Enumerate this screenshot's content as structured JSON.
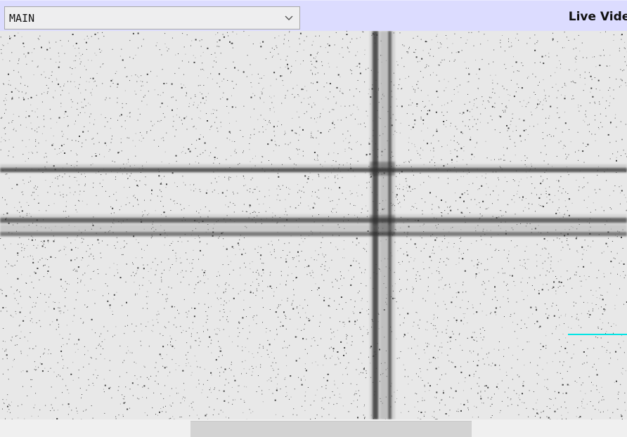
{
  "toolbar": {
    "camera_select": {
      "selected": "MAIN"
    },
    "title": "Live Video"
  },
  "video": {
    "description": "",
    "overlay_line_color": "#00e5e5",
    "crosshair_colors": {
      "line": "#3a3a3a",
      "halo": "#6d6d6d"
    }
  },
  "scrollbar": {
    "position_fraction": 0.55
  },
  "icons": {
    "dropdown_chevron": "chevron-down-icon"
  }
}
